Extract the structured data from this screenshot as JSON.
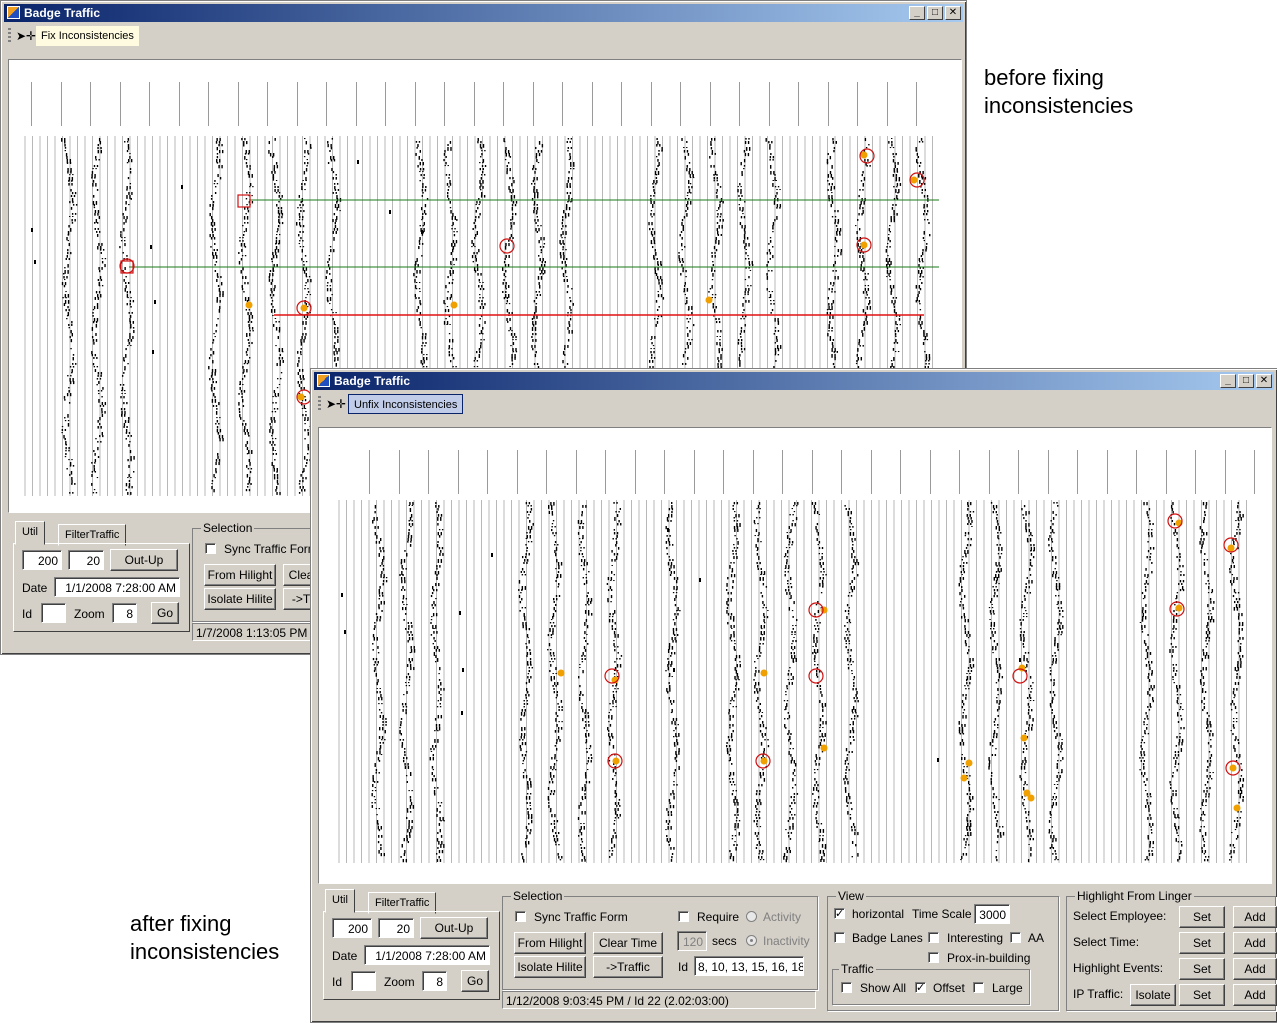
{
  "annotations": {
    "before_line1": "before fixing",
    "before_line2": "inconsistencies",
    "after_line1": "after fixing",
    "after_line2": "inconsistencies"
  },
  "window_before": {
    "title": "Badge Traffic",
    "toolbar_button": "Fix Inconsistencies",
    "tabs": [
      "Util",
      "FilterTraffic"
    ],
    "util": {
      "field1": "200",
      "field2": "20",
      "outup": "Out-Up",
      "date_label": "Date",
      "date_value": "1/1/2008 7:28:00 AM",
      "id_label": "Id",
      "id_value": "",
      "zoom_label": "Zoom",
      "zoom_value": "8",
      "go": "Go"
    },
    "selection": {
      "label": "Selection",
      "sync": "Sync Traffic Form",
      "from_hilight": "From Hilight",
      "clear_time": "Clea",
      "isolate_hilite": "Isolate Hilite",
      "to_traffic": "->T"
    },
    "status": "1/7/2008 1:13:05 PM /"
  },
  "window_after": {
    "title": "Badge Traffic",
    "toolbar_button": "Unfix Inconsistencies",
    "tabs": [
      "Util",
      "FilterTraffic"
    ],
    "util": {
      "field1": "200",
      "field2": "20",
      "outup": "Out-Up",
      "date_label": "Date",
      "date_value": "1/1/2008 7:28:00 AM",
      "id_label": "Id",
      "id_value": "",
      "zoom_label": "Zoom",
      "zoom_value": "8",
      "go": "Go"
    },
    "selection": {
      "label": "Selection",
      "sync": "Sync Traffic Form",
      "require": "Require",
      "activity": "Activity",
      "secs_value": "120",
      "secs": "secs",
      "inactivity": "Inactivity",
      "from_hilight": "From Hilight",
      "clear_time": "Clear Time",
      "isolate_hilite": "Isolate Hilite",
      "to_traffic": "->Traffic",
      "id_label": "Id",
      "id_value": "8, 10, 13, 15, 16, 18,"
    },
    "status": "1/12/2008 9:03:45 PM / Id 22 (2.02:03:00)",
    "view": {
      "label": "View",
      "horizontal": "horizontal",
      "time_scale_label": "Time Scale",
      "time_scale_value": "3000",
      "badge_lanes": "Badge Lanes",
      "interesting": "Interesting",
      "aa": "AA",
      "prox": "Prox-in-building",
      "traffic_label": "Traffic",
      "show_all": "Show All",
      "offset": "Offset",
      "large": "Large"
    },
    "highlight": {
      "label": "Highlight From Linger",
      "rows": [
        {
          "label": "Select Employee:",
          "set": "Set",
          "add": "Add"
        },
        {
          "label": "Select Time:",
          "set": "Set",
          "add": "Add"
        },
        {
          "label": "Highlight Events:",
          "set": "Set",
          "add": "Add"
        },
        {
          "label": "IP Traffic:",
          "isolate": "Isolate",
          "set": "Set",
          "add": "Add"
        }
      ]
    }
  },
  "colors": {
    "title_start": "#0a246a",
    "title_end": "#a6caf0",
    "highlight_circle": "#d01010",
    "event_dot": "#f0a000",
    "linger_line": "#1a7a1a",
    "fix_line": "#e01010"
  }
}
